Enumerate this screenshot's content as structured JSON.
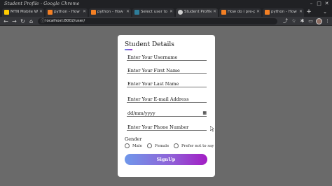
{
  "window": {
    "title": "Student Profile - Google Chrome",
    "controls": {
      "minimize": "–",
      "maximize": "□",
      "close": "✕"
    }
  },
  "tabs": [
    {
      "label": "MTN Mobile W",
      "favicon_color": "#ffcc00",
      "active": false
    },
    {
      "label": "python - How t",
      "favicon_color": "#f48024",
      "active": false
    },
    {
      "label": "python - How t",
      "favicon_color": "#f48024",
      "active": false
    },
    {
      "label": "Select user to c",
      "favicon_color": "#2e7d9a",
      "active": false
    },
    {
      "label": "Student Profile",
      "favicon_color": "#cfcfcf",
      "active": true
    },
    {
      "label": "How do i pre-p",
      "favicon_color": "#f48024",
      "active": false
    },
    {
      "label": "python - How t",
      "favicon_color": "#f48024",
      "active": false
    }
  ],
  "navbar": {
    "url": "localhost:8002/user/",
    "back_icon": "arrow-left-icon",
    "forward_icon": "arrow-right-icon",
    "reload_icon": "reload-icon",
    "home_icon": "home-icon"
  },
  "form": {
    "title": "Student Details",
    "fields": {
      "username": "Enter Your Username",
      "first_name": "Enter Your First Name",
      "last_name": "Enter Your Last Name",
      "email": "Enter Your E-mail Address",
      "dob": "dd/mm/yyyy",
      "phone": "Enter Your Phone Number"
    },
    "gender_label": "Gender",
    "gender_options": [
      "Male",
      "Female",
      "Prefer not to say"
    ],
    "submit_label": "SignUp",
    "accent_start": "#6f97ea",
    "accent_end": "#a31dc4"
  }
}
